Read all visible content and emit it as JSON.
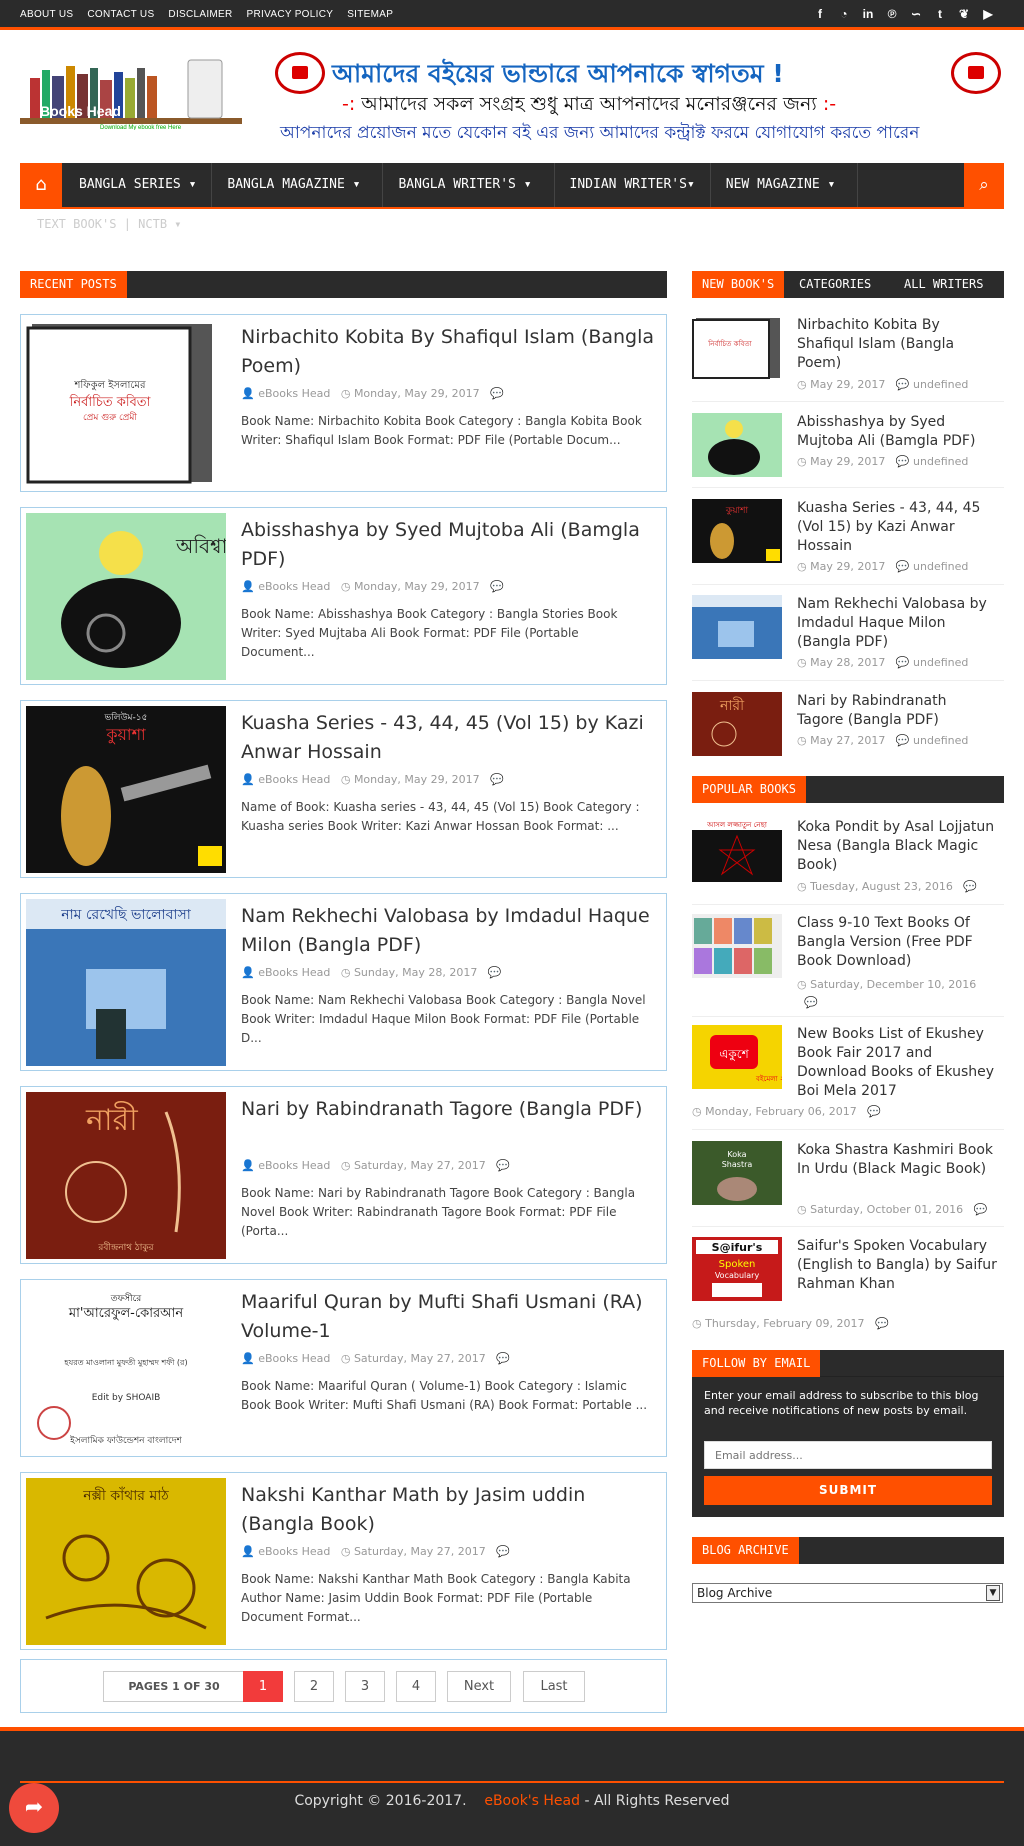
{
  "topbar": {
    "links": [
      "ABOUT US",
      "CONTACT US",
      "DISCLAIMER",
      "PRIVACY POLICY",
      "SITEMAP"
    ],
    "social_icons": [
      "facebook-icon",
      "rss-icon",
      "linkedin-icon",
      "pinterest-icon",
      "stumbleupon-icon",
      "tumblr-icon",
      "twitter-icon",
      "youtube-icon"
    ]
  },
  "logo": {
    "text": "Books Head",
    "tagline": "Download My ebook free Here"
  },
  "banner": {
    "line1": "আমাদের বইয়ের ভান্ডারে আপনাকে স্বাগতম !",
    "line2": "আমাদের সকল সংগ্রহ শুধু মাত্র আপনাদের মনোরঞ্জনের জন্য",
    "line3": "আপনাদের প্রয়োজন মতে যেকোন বই এর জন্য আমাদের কন্ট্রাক্ট ফরমে যোগাযোগ করতে পারেন",
    "seal_text": "Books Head"
  },
  "nav": {
    "items": [
      "BANGLA SERIES",
      "BANGLA MAGAZINE",
      "BANGLA WRITER'S",
      "INDIAN WRITER'S",
      "NEW MAGAZINE"
    ],
    "sub_item": "TEXT BOOK'S | NCTB"
  },
  "recent_posts": {
    "heading": "RECENT POSTS",
    "posts": [
      {
        "title": "Nirbachito Kobita By Shafiqul Islam (Bangla Poem)",
        "author": "eBooks Head",
        "date": "Monday, May 29, 2017",
        "excerpt": "Book Name:  Nirbachito Kobita Book Category :  Bangla Kobita Book Writer:  Shafiqul Islam Book Format:   PDF File (Portable Docum..."
      },
      {
        "title": "Abisshashya by Syed Mujtoba Ali (Bamgla PDF)",
        "author": "eBooks Head",
        "date": "Monday, May 29, 2017",
        "excerpt": "Book Name:  Abisshashya Book Category :  Bangla Stories Book Writer:  Syed Mujtaba Ali Book Format: PDF File (Portable Document..."
      },
      {
        "title": "Kuasha Series - 43, 44, 45 (Vol 15) by Kazi Anwar Hossain",
        "author": "eBooks Head",
        "date": "Monday, May 29, 2017",
        "excerpt": "Name of Book: Kuasha series  - 43, 44, 45 (Vol 15) Book Category :  Kuasha series Book Writer:  Kazi Anwar Hossan Book Format: ..."
      },
      {
        "title": "Nam Rekhechi Valobasa by Imdadul Haque Milon (Bangla PDF)",
        "author": "eBooks Head",
        "date": "Sunday, May 28, 2017",
        "excerpt": "Book Name: Nam Rekhechi Valobasa Book Category :  Bangla Novel Book Writer:  Imdadul Haque Milon Book Format:  PDF File (Portable D..."
      },
      {
        "title": "Nari by Rabindranath Tagore (Bangla PDF)",
        "author": "eBooks Head",
        "date": "Saturday, May 27, 2017",
        "excerpt": "Book Name: Nari by Rabindranath Tagore Book Category :  Bangla Novel Book Writer:  Rabindranath Tagore Book Format:   PDF File (Porta..."
      },
      {
        "title": "Maariful Quran by Mufti Shafi Usmani (RA) Volume-1",
        "author": "eBooks Head",
        "date": "Saturday, May 27, 2017",
        "excerpt": "Book Name:  Maariful Quran ( Volume-1) Book Category :  Islamic Book Book Writer:  Mufti Shafi Usmani (RA) Book Format:  Portable ..."
      },
      {
        "title": "Nakshi Kanthar Math by Jasim uddin (Bangla Book)",
        "author": "eBooks Head",
        "date": "Saturday, May 27, 2017",
        "excerpt": "Book Name: Nakshi Kanthar Math Book Category : Bangla Kabita Author Name: Jasim Uddin Book Format:  PDF File (Portable Document Format..."
      }
    ]
  },
  "pagination": {
    "summary": "PAGES 1 OF 30",
    "pages": [
      "1",
      "2",
      "3",
      "4"
    ],
    "next": "Next",
    "last": "Last"
  },
  "sidebar": {
    "tabs": [
      "NEW BOOK'S",
      "CATEGORIES",
      "ALL WRITERS"
    ],
    "new_books": [
      {
        "title": "Nirbachito Kobita By Shafiqul Islam (Bangla Poem)",
        "date": "May 29, 2017",
        "comments": "undefined"
      },
      {
        "title": "Abisshashya by Syed Mujtoba Ali (Bamgla PDF)",
        "date": "May 29, 2017",
        "comments": "undefined"
      },
      {
        "title": "Kuasha Series - 43, 44, 45 (Vol 15) by Kazi Anwar Hossain",
        "date": "May 29, 2017",
        "comments": "undefined"
      },
      {
        "title": "Nam Rekhechi Valobasa by Imdadul Haque Milon (Bangla PDF)",
        "date": "May 28, 2017",
        "comments": "undefined"
      },
      {
        "title": "Nari by Rabindranath Tagore (Bangla PDF)",
        "date": "May 27, 2017",
        "comments": "undefined"
      }
    ],
    "popular_heading": "POPULAR BOOKS",
    "popular": [
      {
        "title": "Koka Pondit by Asal Lojjatun Nesa (Bangla Black Magic Book)",
        "date": "Tuesday, August 23, 2016"
      },
      {
        "title": "Class   9-10 Text Books Of Bangla Version (Free PDF Book Download)",
        "date": "Saturday, December 10, 2016"
      },
      {
        "title": "New Books List of Ekushey Book Fair 2017 and Download Books of Ekushey Boi Mela 2017",
        "date": "Monday, February 06, 2017"
      },
      {
        "title": "Koka Shastra Kashmiri Book In Urdu (Black Magic Book)",
        "date": "Saturday, October 01, 2016"
      },
      {
        "title": "Saifur's Spoken Vocabulary (English to Bangla) by Saifur Rahman Khan",
        "date": "Thursday, February 09, 2017"
      }
    ],
    "follow": {
      "heading": "FOLLOW BY EMAIL",
      "text": "Enter your email address to subscribe to this blog and receive notifications of new posts by email.",
      "placeholder": "Email address...",
      "submit": "SUBMIT"
    },
    "archive": {
      "heading": "BLOG ARCHIVE",
      "selected": "Blog Archive"
    }
  },
  "footer": {
    "prefix": "Copyright © 2016-2017.",
    "site": "eBook's Head",
    "suffix": " - All Rights Reserved"
  },
  "colors": {
    "accent": "#ff5000",
    "dark": "#2b2b2b",
    "border": "#a9d0ea"
  }
}
